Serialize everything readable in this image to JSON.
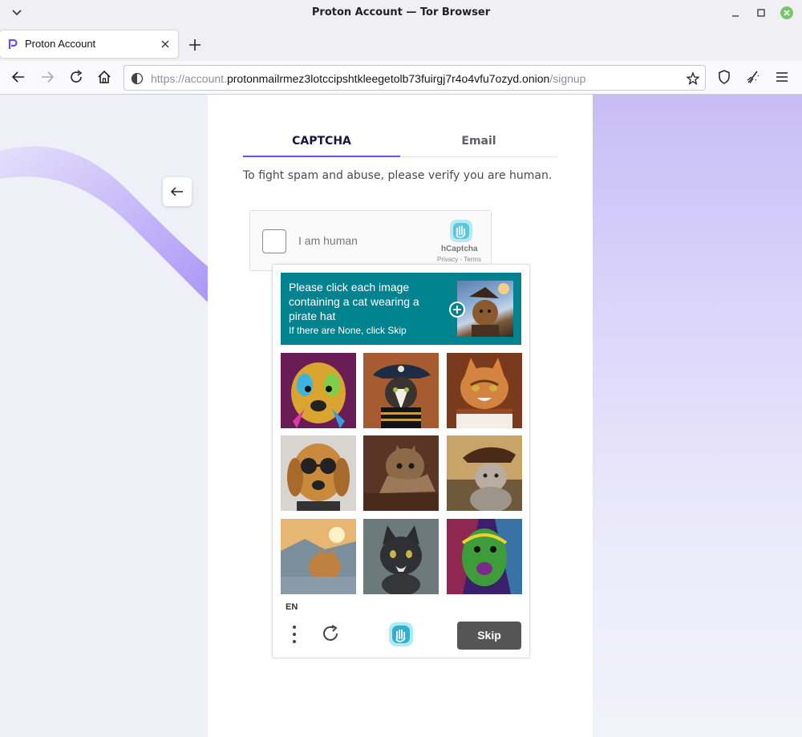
{
  "window": {
    "title": "Proton Account — Tor Browser"
  },
  "tab": {
    "label": "Proton Account"
  },
  "urlbar": {
    "prefix": "https://account.",
    "host": "protonmailrmez3lotccipshtkleegetolb73fuirgj7r4o4vfu7ozyd.onion",
    "path": "/signup"
  },
  "signup": {
    "tabs": [
      {
        "label": "CAPTCHA",
        "active": true
      },
      {
        "label": "Email",
        "active": false
      }
    ],
    "verify_text": "To fight spam and abuse, please verify you are human."
  },
  "hcaptcha_widget": {
    "checkbox_label": "I am human",
    "brand": "hCaptcha",
    "links": "Privacy - Terms"
  },
  "challenge": {
    "prompt": "Please click each image containing a cat wearing a pirate hat",
    "subprompt": "If there are None, click Skip",
    "images": [
      "dog-rainbow",
      "cat-pirate-hat",
      "cat-tabby",
      "dog-sunglasses",
      "cat-tabby-leaning",
      "cat-pirate-sunset",
      "cat-mountain-sunset",
      "cat-black-kitten",
      "dog-rainbow-2"
    ],
    "language": "EN",
    "skip_label": "Skip"
  },
  "colors": {
    "accent": "#6d4aff",
    "prompt_bg": "#00838f",
    "skip_bg": "#555555"
  }
}
